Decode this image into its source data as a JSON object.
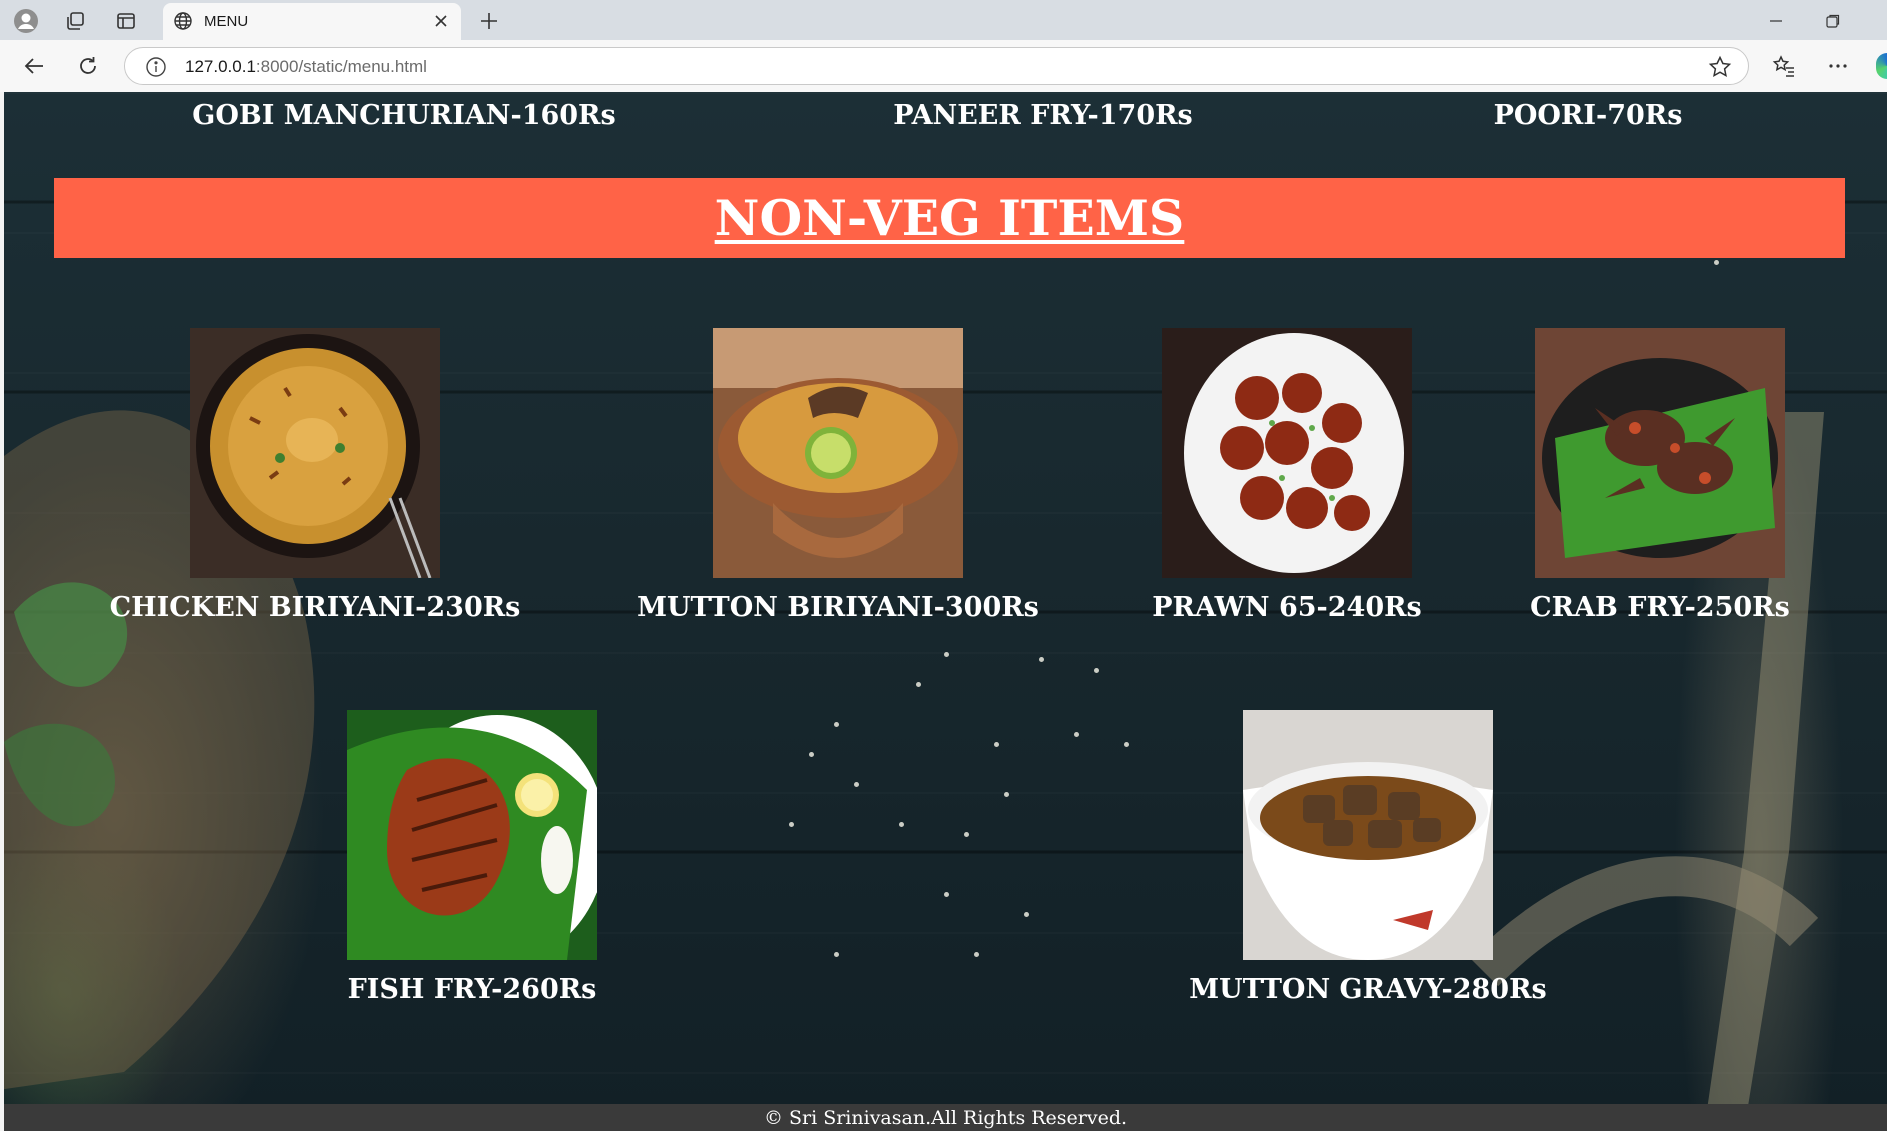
{
  "browser": {
    "tab_title": "MENU",
    "url_host": "127.0.0.1",
    "url_path": ":8000/static/menu.html"
  },
  "veg_row": [
    {
      "name": "GOBI MANCHURIAN-160Rs"
    },
    {
      "name": "PANEER FRY-170Rs"
    },
    {
      "name": "POORI-70Rs"
    }
  ],
  "nonveg": {
    "title": "NON-VEG ITEMS",
    "items": [
      {
        "name": "CHICKEN BIRIYANI-230Rs"
      },
      {
        "name": "MUTTON BIRIYANI-300Rs"
      },
      {
        "name": "PRAWN 65-240Rs"
      },
      {
        "name": "CRAB FRY-250Rs"
      },
      {
        "name": "FISH FRY-260Rs"
      },
      {
        "name": "MUTTON GRAVY-280Rs"
      }
    ]
  },
  "footer": {
    "text": "© Sri Srinivasan.All Rights Reserved."
  },
  "colors": {
    "banner": "#ff6347",
    "footer": "#3a3a3a",
    "page_background": "#1c2f36"
  }
}
